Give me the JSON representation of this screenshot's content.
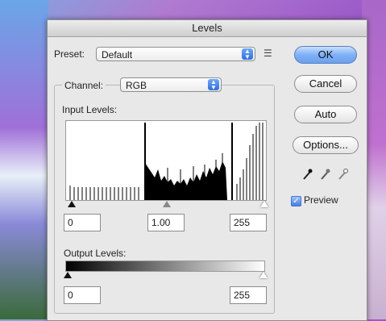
{
  "window": {
    "title": "Levels"
  },
  "preset": {
    "label": "Preset:",
    "value": "Default",
    "menu_icon": "list-menu-icon"
  },
  "channel": {
    "label": "Channel:",
    "value": "RGB"
  },
  "input_levels": {
    "label": "Input Levels:",
    "black": "0",
    "gamma": "1.00",
    "white": "255"
  },
  "output_levels": {
    "label": "Output Levels:",
    "black": "0",
    "white": "255"
  },
  "buttons": {
    "ok": "OK",
    "cancel": "Cancel",
    "auto": "Auto",
    "options": "Options..."
  },
  "preview": {
    "label": "Preview",
    "checked": true
  },
  "eyedroppers": [
    "black-point-eyedropper-icon",
    "gray-point-eyedropper-icon",
    "white-point-eyedropper-icon"
  ],
  "colors": {
    "default_button": "#6aa0ee",
    "select_arrow": "#2f6fe0"
  }
}
